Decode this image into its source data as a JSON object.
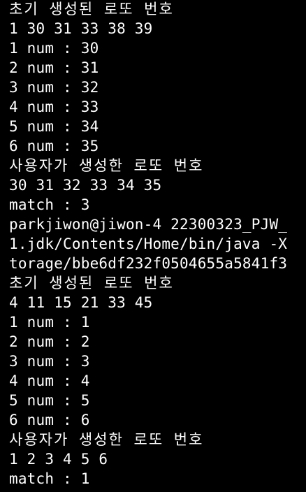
{
  "terminal": {
    "lines": [
      "초기 생성된 로또 번호",
      "1 30 31 33 38 39",
      "1 num : 30",
      "2 num : 31",
      "3 num : 32",
      "4 num : 33",
      "5 num : 34",
      "6 num : 35",
      "사용자가 생성한 로또 번호",
      "30 31 32 33 34 35",
      "match : 3",
      "parkjiwon@jiwon-4 22300323_PJW_",
      "1.jdk/Contents/Home/bin/java -X",
      "torage/bbe6df232f0504655a5841f3",
      "초기 생성된 로또 번호",
      "4 11 15 21 33 45",
      "1 num : 1",
      "2 num : 2",
      "3 num : 3",
      "4 num : 4",
      "5 num : 5",
      "6 num : 6",
      "사용자가 생성한 로또 번호",
      "1 2 3 4 5 6",
      "match : 1"
    ],
    "text_color": "#ffffff",
    "background_color": "#000000"
  }
}
